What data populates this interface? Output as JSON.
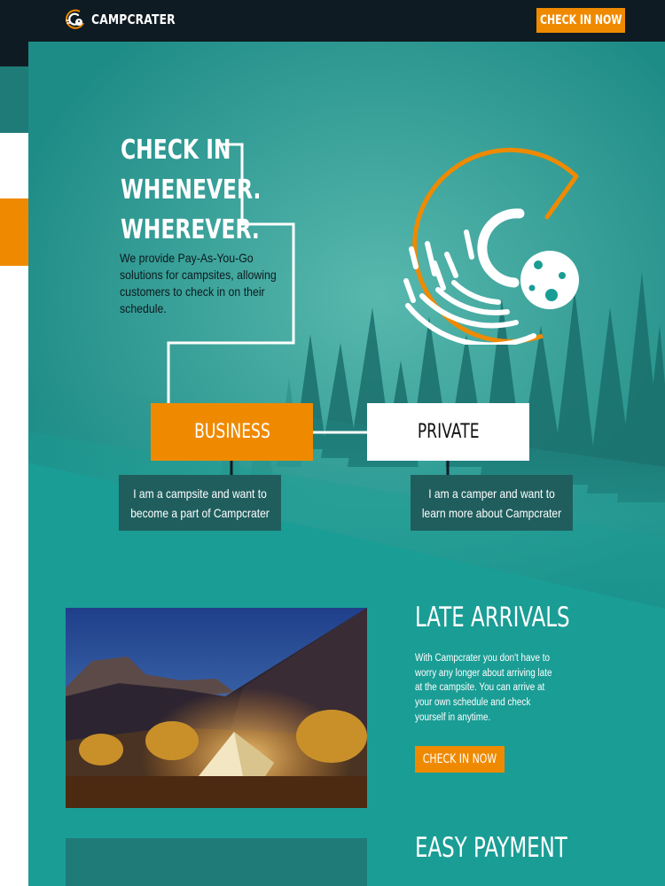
{
  "header": {
    "brand": "CAMPCRATER",
    "cta_label": "CHECK IN NOW",
    "logo_icon": "campcrater-logo-icon"
  },
  "hero": {
    "title_lines": [
      "CHECK IN",
      "WHENEVER.",
      "WHEREVER."
    ],
    "description": "We provide Pay-As-You-Go solutions for campsites, allowing customers to check in on their schedule.",
    "logo_icon": "campcrater-crater-logo-icon",
    "background": "misty-forest-image"
  },
  "choices": {
    "business_label": "BUSINESS",
    "business_desc": "I am a campsite and want to become a part of Campcrater",
    "private_label": "PRIVATE",
    "private_desc": "I am a camper and want to learn more about Campcrater"
  },
  "late_arrivals": {
    "title": "LATE ARRIVALS",
    "description": "With Campcrater you don't have to worry any longer about arriving late at the campsite. You can arrive at your own schedule and check yourself in anytime.",
    "cta_label": "CHECK IN NOW",
    "image": "tent-at-night-photo"
  },
  "easy_payment": {
    "title": "EASY PAYMENT"
  },
  "colors": {
    "accent": "#ef8a00",
    "teal": "#1a9d95",
    "dark": "#0f1b22",
    "dark_teal": "#205e5e"
  }
}
